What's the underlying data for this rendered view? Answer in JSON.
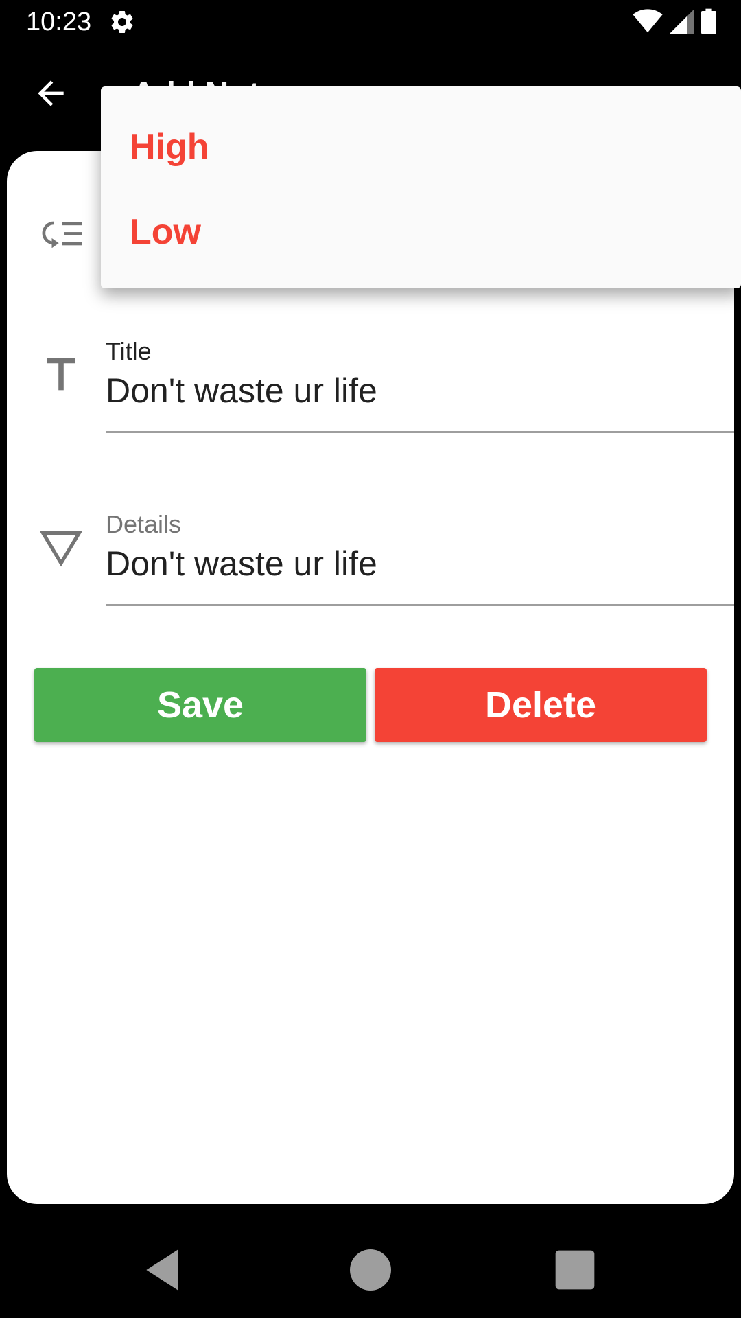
{
  "status_bar": {
    "time": "10:23",
    "icons": [
      "settings-icon",
      "wifi-icon",
      "signal-icon",
      "battery-icon"
    ]
  },
  "app_bar": {
    "title": "Add Note",
    "back_icon": "arrow-left-icon"
  },
  "form": {
    "priority_icon": "priority-list-icon",
    "title_field": {
      "label": "Title",
      "value": "Don't waste ur life",
      "icon": "text-t-icon"
    },
    "details_field": {
      "label": "Details",
      "value": "Don't waste ur life",
      "icon": "triangle-down-icon"
    },
    "save_label": "Save",
    "delete_label": "Delete"
  },
  "dropdown": {
    "options": [
      {
        "label": "High"
      },
      {
        "label": "Low"
      }
    ]
  },
  "nav_bar": {
    "icons": [
      "nav-back-icon",
      "nav-home-icon",
      "nav-recents-icon"
    ]
  },
  "colors": {
    "save": "#4caf50",
    "delete": "#f44336",
    "option_text": "#f44336",
    "background": "#000000",
    "card": "#ffffff"
  }
}
